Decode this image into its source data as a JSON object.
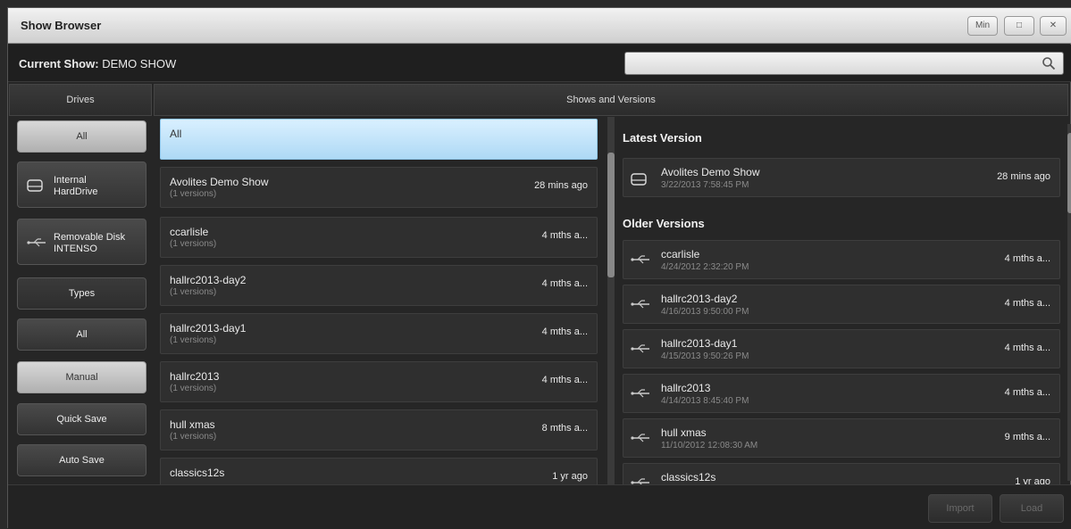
{
  "window": {
    "title": "Show Browser",
    "buttons": [
      "Min",
      "□",
      "✕"
    ]
  },
  "current_show": {
    "label": "Current Show:",
    "value": "DEMO SHOW"
  },
  "search": {
    "placeholder": ""
  },
  "headers": {
    "drives": "Drives",
    "shows": "Shows and Versions"
  },
  "drives": [
    {
      "label": "All"
    },
    {
      "line1": "Internal",
      "line2": "HardDrive"
    },
    {
      "line1": "Removable Disk",
      "line2": "INTENSO"
    }
  ],
  "types_header": "Types",
  "types": [
    "All",
    "Manual",
    "Quick Save",
    "Auto Save"
  ],
  "shows": [
    {
      "name": "All",
      "sub": "",
      "time": ""
    },
    {
      "name": "Avolites Demo Show",
      "sub": "(1 versions)",
      "time": "28 mins ago"
    },
    {
      "name": "ccarlisle",
      "sub": "(1 versions)",
      "time": "4 mths a..."
    },
    {
      "name": "hallrc2013-day2",
      "sub": "(1 versions)",
      "time": "4 mths a..."
    },
    {
      "name": "hallrc2013-day1",
      "sub": "(1 versions)",
      "time": "4 mths a..."
    },
    {
      "name": "hallrc2013",
      "sub": "(1 versions)",
      "time": "4 mths a..."
    },
    {
      "name": "hull xmas",
      "sub": "(1 versions)",
      "time": "8 mths a..."
    },
    {
      "name": "classics12s",
      "sub": "",
      "time": "1 yr ago"
    }
  ],
  "latest_header": "Latest Version",
  "latest": {
    "name": "Avolites Demo Show",
    "date": "3/22/2013 7:58:45 PM",
    "time": "28 mins ago"
  },
  "older_header": "Older Versions",
  "older": [
    {
      "name": "ccarlisle",
      "date": "4/24/2012 2:32:20 PM",
      "time": "4 mths a..."
    },
    {
      "name": "hallrc2013-day2",
      "date": "4/16/2013 9:50:00 PM",
      "time": "4 mths a..."
    },
    {
      "name": "hallrc2013-day1",
      "date": "4/15/2013 9:50:26 PM",
      "time": "4 mths a..."
    },
    {
      "name": "hallrc2013",
      "date": "4/14/2013 8:45:40 PM",
      "time": "4 mths a..."
    },
    {
      "name": "hull xmas",
      "date": "11/10/2012 12:08:30 AM",
      "time": "9 mths a..."
    },
    {
      "name": "classics12s",
      "date": "",
      "time": "1 yr ago"
    }
  ],
  "bottom": {
    "import": "Import",
    "load": "Load"
  }
}
